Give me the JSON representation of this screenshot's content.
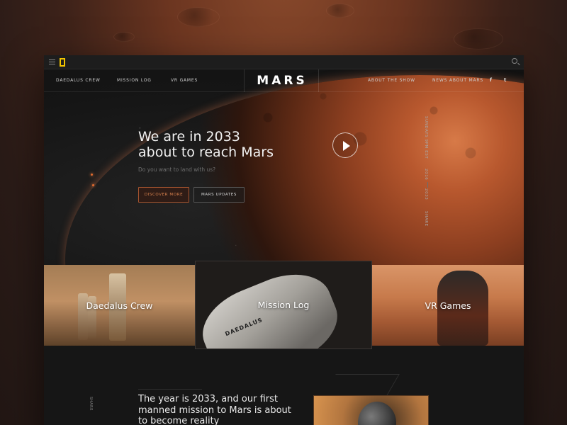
{
  "topbar": {
    "menu_icon": "hamburger-icon",
    "logo_icon": "national-geographic-logo",
    "search_icon": "search-icon"
  },
  "nav": {
    "left_links": [
      "DAEDALUS CREW",
      "MISSION LOG",
      "VR GAMES"
    ],
    "brand": "MARS",
    "right_links": [
      "ABOUT THE SHOW",
      "NEWS ABOUT MARS"
    ],
    "social": {
      "facebook": "f",
      "twitter": "t"
    }
  },
  "hero": {
    "headline_line1": "We are in 2033",
    "headline_line2": "about to reach Mars",
    "subtitle": "Do you want to land with us?",
    "discover_label": "DISCOVER MORE",
    "updates_label": "MARS UPDATES",
    "play_icon": "play-icon",
    "side_schedule": "SUNDAYS 9PM EST",
    "side_year_start": "2016",
    "side_year_end": "2033",
    "side_share": "SHARE"
  },
  "cards": [
    {
      "label": "Daedalus Crew"
    },
    {
      "label": "Mission Log",
      "ship_name": "DAEDALUS"
    },
    {
      "label": "VR Games"
    }
  ],
  "bottom": {
    "share": "SHARE",
    "title": "The year is 2033, and our first manned mission to Mars is about to become reality"
  },
  "colors": {
    "accent": "#d9824e",
    "background": "#141414",
    "logo_yellow": "#f2c400"
  }
}
